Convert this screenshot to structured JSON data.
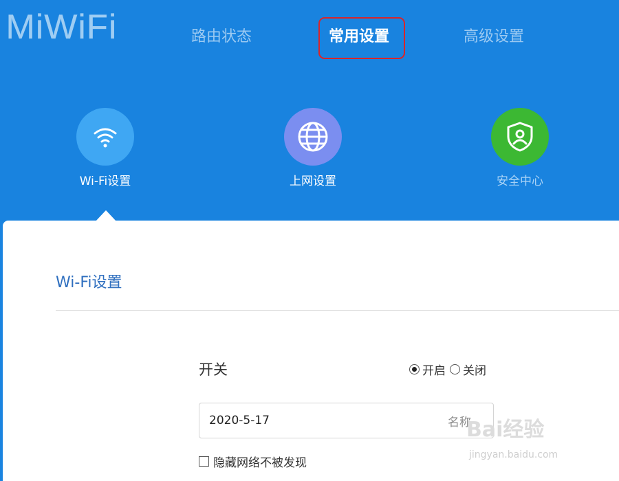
{
  "header": {
    "logo": "MiWiFi",
    "tabs": [
      {
        "label": "路由状态",
        "active": false
      },
      {
        "label": "常用设置",
        "active": true
      },
      {
        "label": "高级设置",
        "active": false
      }
    ]
  },
  "features": [
    {
      "label": "Wi-Fi设置",
      "icon": "wifi-icon",
      "color": "#3fa7f3"
    },
    {
      "label": "上网设置",
      "icon": "globe-icon",
      "color": "#7b8ef0"
    },
    {
      "label": "安全中心",
      "icon": "shield-user-icon",
      "color": "#3cb833"
    }
  ],
  "panel": {
    "title": "Wi-Fi设置",
    "switch": {
      "label": "开关",
      "options": [
        "开启",
        "关闭"
      ],
      "selected": "开启"
    },
    "name_field": {
      "value": "2020-5-17",
      "hint": "名称"
    },
    "hide_network": {
      "label": "隐藏网络不被发现",
      "checked": false
    }
  },
  "watermark": {
    "brand": "Bai经验",
    "url": "jingyan.baidu.com"
  },
  "colors": {
    "header_bg": "#1983df",
    "accent_title": "#2f6fbf",
    "highlight_border": "#d9252a"
  }
}
